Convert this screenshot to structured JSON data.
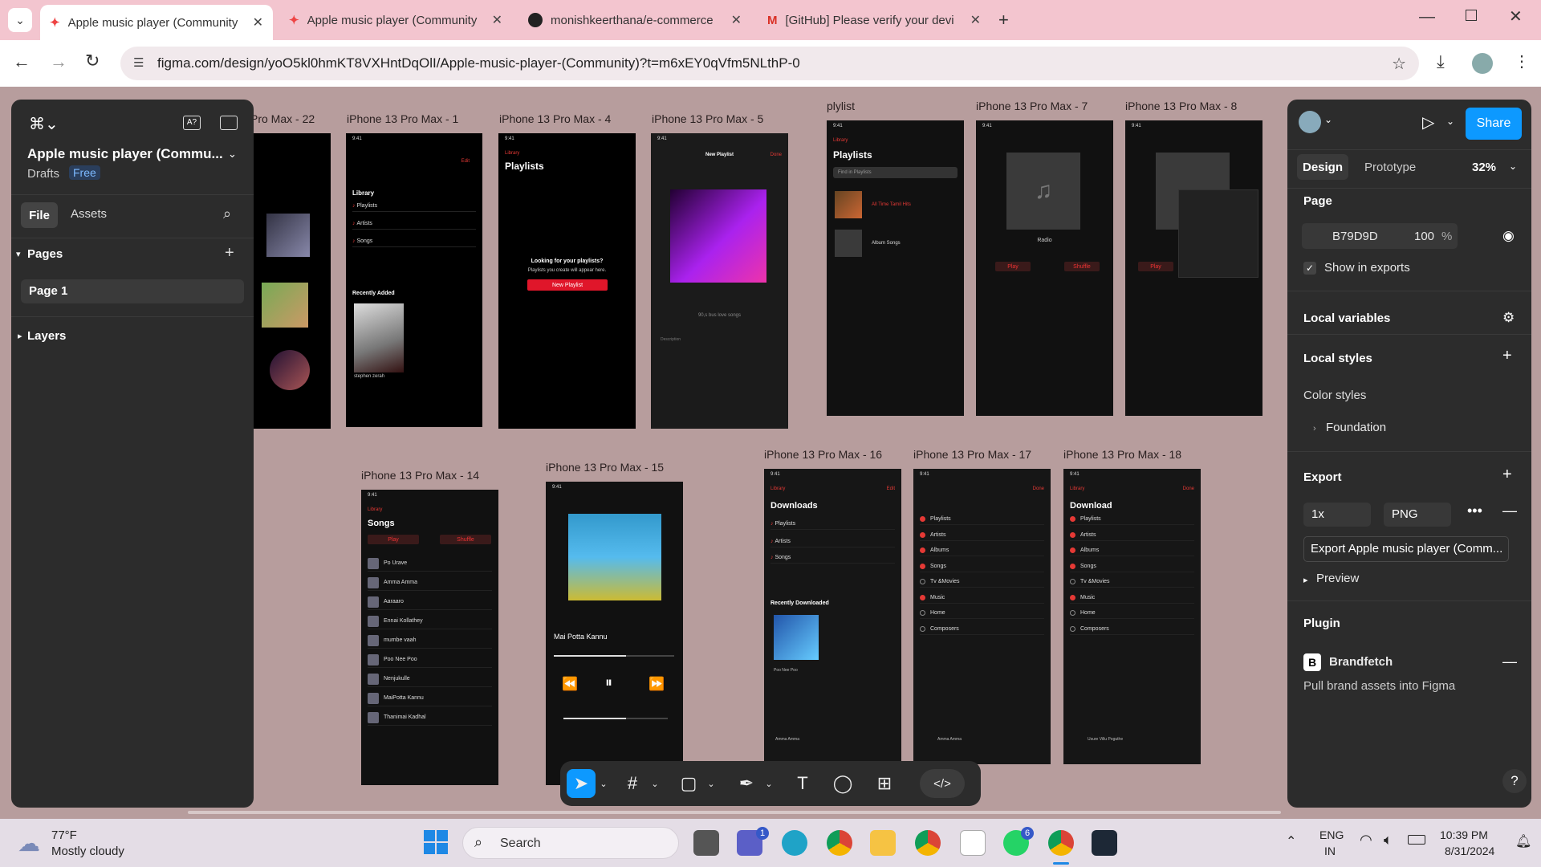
{
  "browser": {
    "tabs": [
      {
        "title": "Apple music player (Community",
        "active": true,
        "icon": "figma-icon"
      },
      {
        "title": "Apple music player (Community",
        "active": false,
        "icon": "figma-icon"
      },
      {
        "title": "monishkeerthana/e-commerce",
        "active": false,
        "icon": "github-icon"
      },
      {
        "title": "[GitHub] Please verify your devi",
        "active": false,
        "icon": "gmail-icon"
      }
    ],
    "url": "figma.com/design/yoO5kl0hmKT8VXHntDqOlI/Apple-music-player-(Community)?t=m6xEY0qVfm5NLthP-0"
  },
  "left_panel": {
    "file_name": "Apple music player (Commu...",
    "drafts_label": "Drafts",
    "plan_badge": "Free",
    "tabs": [
      "File",
      "Assets"
    ],
    "pages_heading": "Pages",
    "page_item": "Page 1",
    "layers_heading": "Layers"
  },
  "frames": {
    "f22": "Pro Max - 22",
    "f1": "iPhone 13 Pro Max - 1",
    "f4": "iPhone 13 Pro Max - 4",
    "f5": "iPhone 13 Pro Max - 5",
    "plylist": "plylist",
    "f7": "iPhone 13 Pro Max - 7",
    "f8": "iPhone 13 Pro Max - 8",
    "f14": "iPhone 13 Pro Max - 14",
    "f15": "iPhone 13 Pro Max - 15",
    "f16": "iPhone 13 Pro Max - 16",
    "f17": "iPhone 13 Pro Max - 17",
    "f18": "iPhone 13 Pro Max - 18"
  },
  "screens": {
    "status_time": "9:41",
    "library": "Library",
    "edit": "Edit",
    "done": "Done",
    "playlists": "Playlists",
    "artists": "Artists",
    "songs": "Songs",
    "recently_added": "Recently Added",
    "artist_name": "stephen zerah",
    "looking_title": "Looking for your playlists?",
    "looking_sub": "Playlists you create will appear here.",
    "new_playlist": "New Playlist",
    "playlist_name": "90,s bus love songs",
    "description": "Description",
    "find_placeholder": "Find in Playlists",
    "all_time_tamil": "All Time Tamil Hits",
    "album_songs": "Album Songs",
    "radio": "Radio",
    "play": "Play",
    "shuffle": "Shuffle",
    "songs_title": "Songs",
    "downloads_title": "Downloads",
    "download_title": "Download",
    "recently_downloaded": "Recently Downloaded",
    "poo_nee_poo": "Poo Nee Poo",
    "mai_potta": "Mai Potta Kannu",
    "amma_amma": "Amma Amma",
    "usure": "Usure Villu Poguthe",
    "edit_items": [
      "Playlists",
      "Artists",
      "Albums",
      "Songs",
      "Tv &Movies",
      "Music",
      "Home",
      "Composers"
    ],
    "song_list": [
      "Po Urave",
      "Amma Amma",
      "Aaraaro",
      "Ennai Kollathey",
      "mumbe vaah",
      "Poo Nee Poo",
      "Nenjukulle",
      "MaiPotta Kannu",
      "Thanimai Kadhal"
    ]
  },
  "right_panel": {
    "share": "Share",
    "tabs": [
      "Design",
      "Prototype"
    ],
    "zoom": "32%",
    "page_heading": "Page",
    "page_color": "B79D9D",
    "page_opacity": "100",
    "percent": "%",
    "show_in_exports": "Show in exports",
    "local_variables": "Local variables",
    "local_styles": "Local styles",
    "color_styles": "Color styles",
    "foundation": "Foundation",
    "export_heading": "Export",
    "export_scale": "1x",
    "export_format": "PNG",
    "export_button": "Export Apple music player (Comm...",
    "preview": "Preview",
    "plugin_heading": "Plugin",
    "plugin_name": "Brandfetch",
    "plugin_desc": "Pull brand assets into Figma",
    "page_color_hex": "#b79d9d"
  },
  "taskbar": {
    "weather_temp": "77°F",
    "weather_desc": "Mostly cloudy",
    "search": "Search",
    "lang1": "ENG",
    "lang2": "IN",
    "time": "10:39 PM",
    "date": "8/31/2024",
    "teams_badge": "1",
    "whatsapp_badge": "6"
  }
}
